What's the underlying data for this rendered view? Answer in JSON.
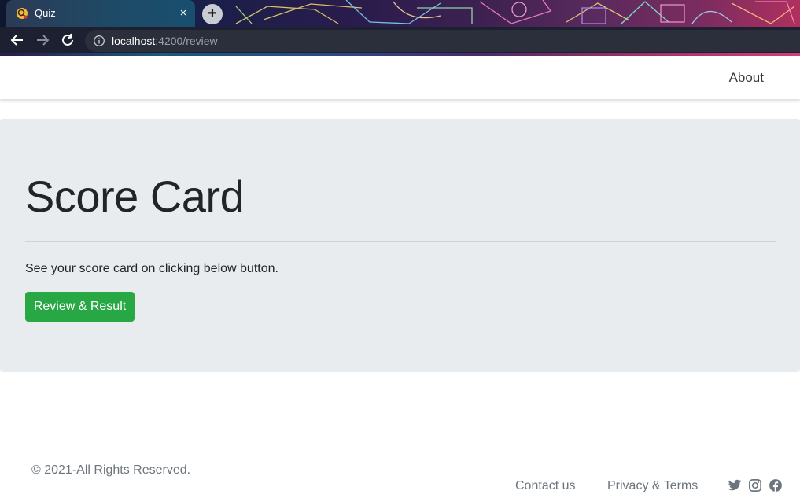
{
  "browser": {
    "tab_title": "Quiz",
    "tab_close": "×",
    "new_tab": "+",
    "url_host": "localhost",
    "url_rest": ":4200/review"
  },
  "navbar": {
    "about_label": "About"
  },
  "jumbotron": {
    "title": "Score Card",
    "lead": "See your score card on clicking below button.",
    "button_label": "Review & Result",
    "button_color": "#28a745"
  },
  "footer": {
    "copyright": "© 2021-All Rights Reserved.",
    "links": [
      "Contact us",
      "Privacy & Terms"
    ],
    "social_icons": [
      "twitter-icon",
      "instagram-icon",
      "facebook-icon"
    ]
  }
}
